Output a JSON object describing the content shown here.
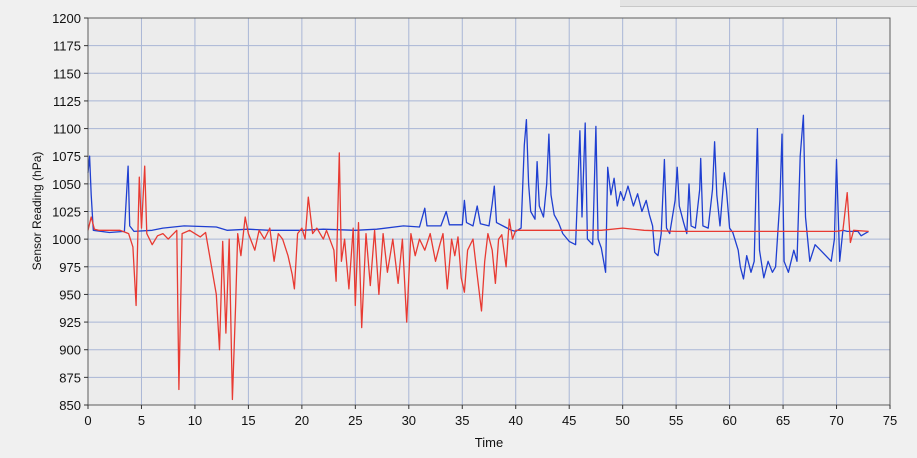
{
  "chart_data": {
    "type": "line",
    "title": "",
    "xlabel": "Time",
    "ylabel": "Sensor Reading (hPa)",
    "xlim": [
      0,
      75
    ],
    "ylim": [
      850,
      1200
    ],
    "x_ticks": [
      0,
      5,
      10,
      15,
      20,
      25,
      30,
      35,
      40,
      45,
      50,
      55,
      60,
      65,
      70,
      75
    ],
    "y_ticks": [
      850,
      875,
      900,
      925,
      950,
      975,
      1000,
      1025,
      1050,
      1075,
      1100,
      1125,
      1150,
      1175,
      1200
    ],
    "grid": true,
    "legend": "none",
    "plot_background": "#ececec",
    "grid_color": "#a9b6d6",
    "series": [
      {
        "color": "#1f3fd1",
        "points": [
          [
            0,
            1060
          ],
          [
            0.15,
            1075
          ],
          [
            0.3,
            1040
          ],
          [
            0.5,
            1008
          ],
          [
            2,
            1006
          ],
          [
            3.4,
            1007
          ],
          [
            3.6,
            1040
          ],
          [
            3.75,
            1066
          ],
          [
            3.9,
            1012
          ],
          [
            4.3,
            1007
          ],
          [
            6,
            1008
          ],
          [
            7,
            1010
          ],
          [
            9,
            1012
          ],
          [
            12,
            1011
          ],
          [
            13,
            1008
          ],
          [
            15,
            1009
          ],
          [
            17,
            1008
          ],
          [
            20,
            1008
          ],
          [
            22,
            1009
          ],
          [
            25,
            1008
          ],
          [
            27,
            1009
          ],
          [
            29.5,
            1012
          ],
          [
            31,
            1011
          ],
          [
            31.5,
            1028
          ],
          [
            31.7,
            1012
          ],
          [
            33,
            1012
          ],
          [
            33.5,
            1025
          ],
          [
            33.8,
            1013
          ],
          [
            35,
            1013
          ],
          [
            35.2,
            1035
          ],
          [
            35.4,
            1015
          ],
          [
            36,
            1012
          ],
          [
            36.4,
            1030
          ],
          [
            36.7,
            1014
          ],
          [
            37.5,
            1012
          ],
          [
            37.8,
            1032
          ],
          [
            38,
            1048
          ],
          [
            38.2,
            1015
          ],
          [
            39,
            1011
          ],
          [
            39.6,
            1008
          ],
          [
            40,
            1007
          ],
          [
            40.5,
            1010
          ],
          [
            40.8,
            1085
          ],
          [
            41,
            1108
          ],
          [
            41.2,
            1050
          ],
          [
            41.4,
            1025
          ],
          [
            41.8,
            1018
          ],
          [
            42,
            1070
          ],
          [
            42.2,
            1030
          ],
          [
            42.6,
            1020
          ],
          [
            42.9,
            1050
          ],
          [
            43.1,
            1095
          ],
          [
            43.3,
            1040
          ],
          [
            43.6,
            1022
          ],
          [
            44,
            1015
          ],
          [
            44.4,
            1005
          ],
          [
            45,
            998
          ],
          [
            45.6,
            995
          ],
          [
            46,
            1098
          ],
          [
            46.2,
            1020
          ],
          [
            46.5,
            1105
          ],
          [
            46.7,
            1000
          ],
          [
            47.2,
            995
          ],
          [
            47.5,
            1102
          ],
          [
            47.7,
            1000
          ],
          [
            48,
            992
          ],
          [
            48.4,
            970
          ],
          [
            48.6,
            1065
          ],
          [
            48.9,
            1040
          ],
          [
            49.2,
            1055
          ],
          [
            49.5,
            1030
          ],
          [
            49.8,
            1043
          ],
          [
            50.1,
            1035
          ],
          [
            50.5,
            1048
          ],
          [
            51,
            1030
          ],
          [
            51.4,
            1041
          ],
          [
            51.8,
            1025
          ],
          [
            52.2,
            1035
          ],
          [
            52.5,
            1022
          ],
          [
            52.8,
            1012
          ],
          [
            53,
            988
          ],
          [
            53.3,
            985
          ],
          [
            53.6,
            1005
          ],
          [
            53.9,
            1072
          ],
          [
            54.1,
            1010
          ],
          [
            54.4,
            1005
          ],
          [
            54.9,
            1035
          ],
          [
            55.1,
            1065
          ],
          [
            55.3,
            1030
          ],
          [
            55.7,
            1015
          ],
          [
            56,
            1005
          ],
          [
            56.2,
            1050
          ],
          [
            56.4,
            1012
          ],
          [
            56.8,
            1010
          ],
          [
            57.2,
            1045
          ],
          [
            57.3,
            1073
          ],
          [
            57.5,
            1012
          ],
          [
            58,
            1010
          ],
          [
            58.4,
            1045
          ],
          [
            58.6,
            1088
          ],
          [
            58.8,
            1040
          ],
          [
            59.1,
            1012
          ],
          [
            59.5,
            1060
          ],
          [
            59.7,
            1045
          ],
          [
            60,
            1010
          ],
          [
            60.3,
            1006
          ],
          [
            60.8,
            990
          ],
          [
            61,
            975
          ],
          [
            61.3,
            964
          ],
          [
            61.6,
            985
          ],
          [
            62,
            970
          ],
          [
            62.3,
            980
          ],
          [
            62.6,
            1100
          ],
          [
            62.8,
            990
          ],
          [
            63.2,
            965
          ],
          [
            63.6,
            980
          ],
          [
            64,
            970
          ],
          [
            64.3,
            975
          ],
          [
            64.7,
            1035
          ],
          [
            64.9,
            1095
          ],
          [
            65.1,
            980
          ],
          [
            65.5,
            970
          ],
          [
            66,
            990
          ],
          [
            66.3,
            980
          ],
          [
            66.6,
            1075
          ],
          [
            66.9,
            1112
          ],
          [
            67.1,
            1020
          ],
          [
            67.5,
            980
          ],
          [
            68,
            995
          ],
          [
            68.5,
            990
          ],
          [
            69,
            985
          ],
          [
            69.5,
            980
          ],
          [
            69.8,
            1000
          ],
          [
            70,
            1072
          ],
          [
            70.3,
            980
          ],
          [
            70.6,
            1008
          ],
          [
            71,
            1007
          ],
          [
            72,
            1007
          ],
          [
            72.3,
            1003
          ],
          [
            73,
            1007
          ]
        ]
      },
      {
        "color": "#e83a32",
        "points": [
          [
            0,
            1008
          ],
          [
            0.3,
            1020
          ],
          [
            0.6,
            1009
          ],
          [
            1,
            1008
          ],
          [
            3,
            1008
          ],
          [
            3.8,
            1005
          ],
          [
            4.2,
            993
          ],
          [
            4.5,
            940
          ],
          [
            4.8,
            1056
          ],
          [
            5,
            1010
          ],
          [
            5.3,
            1066
          ],
          [
            5.5,
            1005
          ],
          [
            6,
            995
          ],
          [
            6.5,
            1003
          ],
          [
            7,
            1005
          ],
          [
            7.5,
            1000
          ],
          [
            8.3,
            1008
          ],
          [
            8.5,
            864
          ],
          [
            8.8,
            1005
          ],
          [
            9.5,
            1008
          ],
          [
            10.5,
            1002
          ],
          [
            11,
            1006
          ],
          [
            12,
            950
          ],
          [
            12.3,
            900
          ],
          [
            12.6,
            998
          ],
          [
            12.9,
            915
          ],
          [
            13.2,
            1000
          ],
          [
            13.5,
            855
          ],
          [
            13.8,
            940
          ],
          [
            14,
            1005
          ],
          [
            14.3,
            985
          ],
          [
            14.7,
            1020
          ],
          [
            15,
            1005
          ],
          [
            15.6,
            990
          ],
          [
            16,
            1008
          ],
          [
            16.5,
            1000
          ],
          [
            17,
            1010
          ],
          [
            17.4,
            980
          ],
          [
            17.8,
            1005
          ],
          [
            18.2,
            1000
          ],
          [
            18.7,
            985
          ],
          [
            19.1,
            968
          ],
          [
            19.3,
            955
          ],
          [
            19.6,
            1005
          ],
          [
            20,
            1010
          ],
          [
            20.3,
            1000
          ],
          [
            20.6,
            1038
          ],
          [
            21,
            1005
          ],
          [
            21.4,
            1010
          ],
          [
            22,
            1000
          ],
          [
            22.3,
            1008
          ],
          [
            23,
            990
          ],
          [
            23.2,
            962
          ],
          [
            23.5,
            1078
          ],
          [
            23.7,
            980
          ],
          [
            24,
            1000
          ],
          [
            24.4,
            955
          ],
          [
            24.8,
            1010
          ],
          [
            25,
            940
          ],
          [
            25.3,
            1015
          ],
          [
            25.6,
            920
          ],
          [
            26,
            1005
          ],
          [
            26.4,
            958
          ],
          [
            26.8,
            1008
          ],
          [
            27.2,
            950
          ],
          [
            27.6,
            1005
          ],
          [
            28,
            970
          ],
          [
            28.5,
            1000
          ],
          [
            29,
            960
          ],
          [
            29.4,
            1000
          ],
          [
            29.8,
            925
          ],
          [
            30.2,
            1005
          ],
          [
            30.6,
            985
          ],
          [
            31,
            1000
          ],
          [
            31.5,
            990
          ],
          [
            32,
            1005
          ],
          [
            32.5,
            980
          ],
          [
            32.9,
            995
          ],
          [
            33.2,
            1005
          ],
          [
            33.6,
            955
          ],
          [
            34,
            1000
          ],
          [
            34.3,
            985
          ],
          [
            34.6,
            1002
          ],
          [
            34.9,
            965
          ],
          [
            35.2,
            952
          ],
          [
            35.5,
            990
          ],
          [
            36,
            1000
          ],
          [
            36.3,
            975
          ],
          [
            36.8,
            935
          ],
          [
            37.1,
            980
          ],
          [
            37.4,
            1005
          ],
          [
            37.8,
            990
          ],
          [
            38.1,
            960
          ],
          [
            38.4,
            1000
          ],
          [
            38.7,
            1004
          ],
          [
            39.1,
            975
          ],
          [
            39.4,
            1018
          ],
          [
            39.7,
            1000
          ],
          [
            40,
            1008
          ],
          [
            45,
            1008
          ],
          [
            48,
            1008
          ],
          [
            50,
            1010
          ],
          [
            52,
            1008
          ],
          [
            55,
            1007
          ],
          [
            60,
            1007
          ],
          [
            65,
            1007
          ],
          [
            70,
            1007
          ],
          [
            70.6,
            1008
          ],
          [
            71,
            1042
          ],
          [
            71.3,
            997
          ],
          [
            71.6,
            1008
          ],
          [
            73,
            1007
          ]
        ]
      }
    ]
  }
}
